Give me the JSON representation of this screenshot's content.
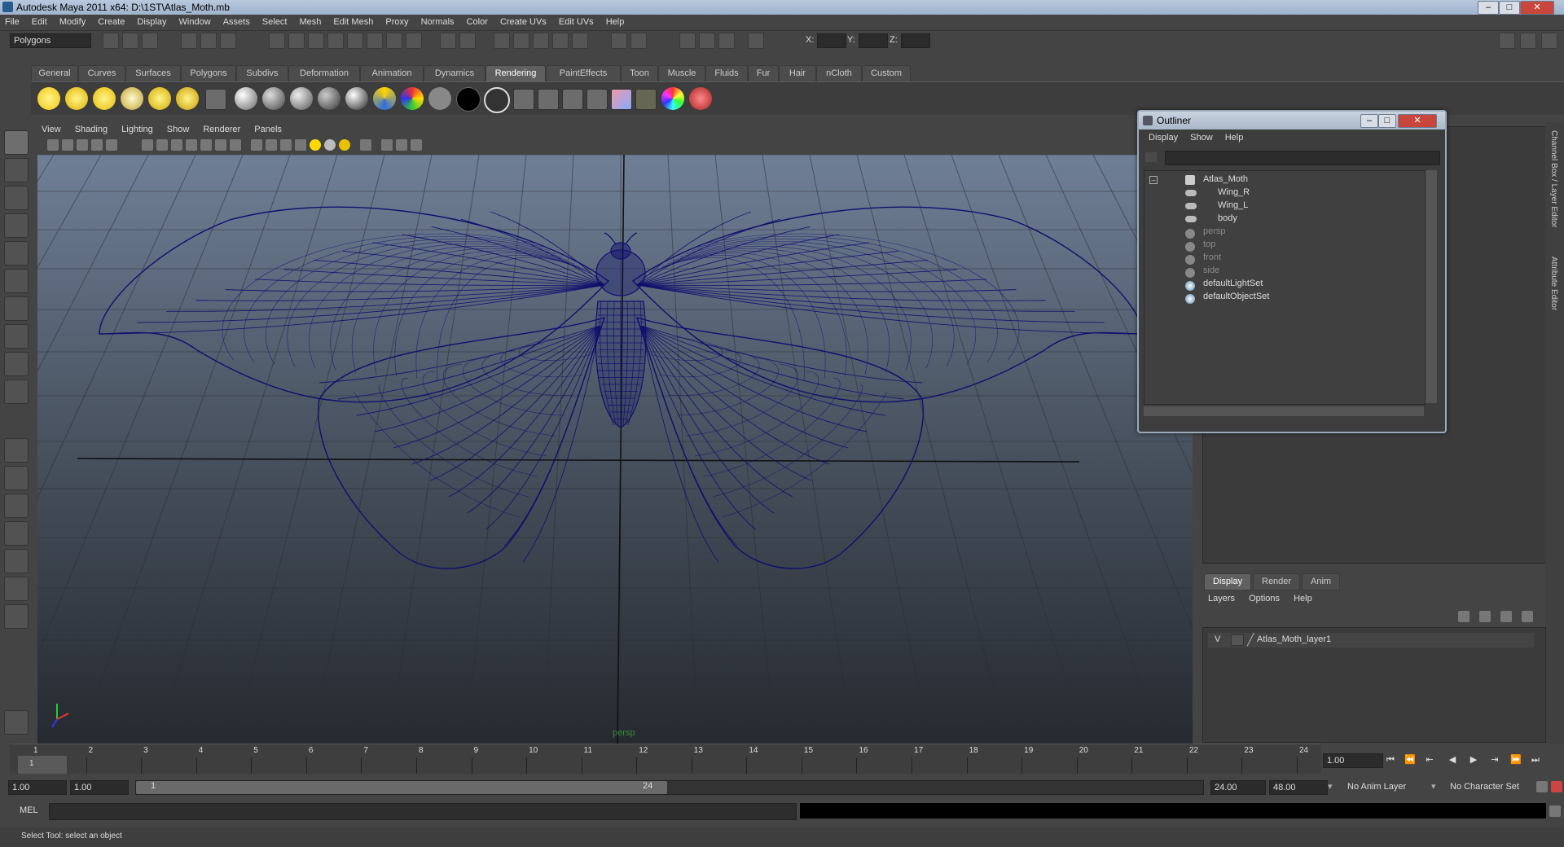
{
  "window": {
    "title": "Autodesk Maya 2011 x64: D:\\1ST\\Atlas_Moth.mb",
    "controls": {
      "minimize": "–",
      "maximize": "□",
      "close": "✕"
    }
  },
  "menubar": [
    "File",
    "Edit",
    "Modify",
    "Create",
    "Display",
    "Window",
    "Assets",
    "Select",
    "Mesh",
    "Edit Mesh",
    "Proxy",
    "Normals",
    "Color",
    "Create UVs",
    "Edit UVs",
    "Help"
  ],
  "statusline": {
    "mode": "Polygons",
    "x_label": "X:",
    "y_label": "Y:",
    "z_label": "Z:"
  },
  "shelf": {
    "tabs": [
      "General",
      "Curves",
      "Surfaces",
      "Polygons",
      "Subdivs",
      "Deformation",
      "Animation",
      "Dynamics",
      "Rendering",
      "PaintEffects",
      "Toon",
      "Muscle",
      "Fluids",
      "Fur",
      "Hair",
      "nCloth",
      "Custom"
    ],
    "active_tab": "Rendering"
  },
  "viewport": {
    "menus": [
      "View",
      "Shading",
      "Lighting",
      "Show",
      "Renderer",
      "Panels"
    ],
    "camera_label": "persp",
    "wire_color": "#10106e"
  },
  "outliner": {
    "title": "Outliner",
    "menus": [
      "Display",
      "Show",
      "Help"
    ],
    "items": [
      {
        "label": "Atlas_Moth",
        "dim": false
      },
      {
        "label": "Wing_R",
        "dim": false
      },
      {
        "label": "Wing_L",
        "dim": false
      },
      {
        "label": "body",
        "dim": false
      },
      {
        "label": "persp",
        "dim": true
      },
      {
        "label": "top",
        "dim": true
      },
      {
        "label": "front",
        "dim": true
      },
      {
        "label": "side",
        "dim": true
      },
      {
        "label": "defaultLightSet",
        "dim": false
      },
      {
        "label": "defaultObjectSet",
        "dim": false
      }
    ]
  },
  "side_tabs": {
    "channel_box": "Channel Box / Layer Editor",
    "attribute_editor": "Attribute Editor"
  },
  "layer_editor": {
    "tabs": [
      "Display",
      "Render",
      "Anim"
    ],
    "active_tab": "Display",
    "menus": [
      "Layers",
      "Options",
      "Help"
    ],
    "layer": {
      "visible": "V",
      "name": "Atlas_Moth_layer1"
    }
  },
  "timeline": {
    "start": 1,
    "end": 24,
    "ticks": [
      "1",
      "2",
      "3",
      "4",
      "5",
      "6",
      "7",
      "8",
      "9",
      "10",
      "11",
      "12",
      "13",
      "14",
      "15",
      "16",
      "17",
      "18",
      "19",
      "20",
      "21",
      "22",
      "23",
      "24"
    ],
    "current_frame_marker": "1",
    "current_frame": "1.00"
  },
  "range": {
    "start_time": "1.00",
    "playback_start": "1.00",
    "slider_start": "1",
    "slider_end": "24",
    "playback_end": "24.00",
    "end_time": "48.00",
    "anim_layer": "No Anim Layer",
    "character_set": "No Character Set"
  },
  "command_line": {
    "label": "MEL"
  },
  "help_line": {
    "text": "Select Tool: select an object"
  }
}
